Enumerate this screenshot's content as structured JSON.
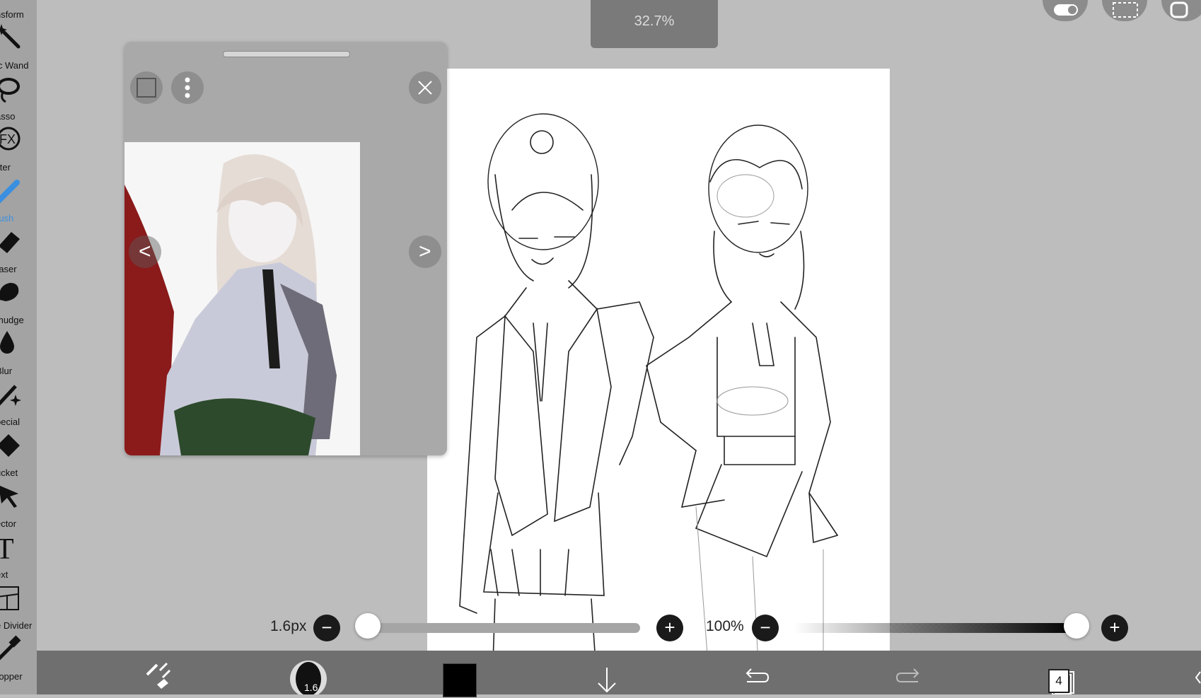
{
  "zoom_level": "32.7%",
  "toolbar": {
    "tools": [
      {
        "label": "nsform",
        "icon": "transform-icon"
      },
      {
        "label": "ic Wand",
        "icon": "magic-wand-icon"
      },
      {
        "label": "asso",
        "icon": "lasso-icon"
      },
      {
        "label": "ilter",
        "icon": "fx-filter-icon"
      },
      {
        "label": "rush",
        "icon": "brush-icon",
        "active": true
      },
      {
        "label": "raser",
        "icon": "eraser-icon"
      },
      {
        "label": "mudge",
        "icon": "smudge-icon"
      },
      {
        "label": "Blur",
        "icon": "blur-drop-icon"
      },
      {
        "label": "pecial",
        "icon": "special-pen-icon"
      },
      {
        "label": "ucket",
        "icon": "bucket-icon"
      },
      {
        "label": "ector",
        "icon": "selector-arrow-icon"
      },
      {
        "label": "ext",
        "icon": "text-t-icon"
      },
      {
        "label": "e Divider",
        "icon": "frame-divider-icon"
      },
      {
        "label": "ropper",
        "icon": "eyedropper-icon"
      }
    ],
    "fx_glyph": "FX",
    "text_glyph": "T"
  },
  "brush_size": {
    "label": "1.6px",
    "value_fraction": 0.04,
    "minus": "−",
    "plus": "+"
  },
  "opacity": {
    "label": "100%",
    "value_fraction": 1.0,
    "minus": "−",
    "plus": "+"
  },
  "bottom_bar": {
    "brush_thumb_label": "1.6",
    "layer_count": "4",
    "current_color": "#000000"
  },
  "reference_window": {
    "prev": "<",
    "next": ">"
  },
  "colors": {
    "accent": "#3b8fe0",
    "toolbar": "#a3a3a3",
    "bottom_bar": "#6f6f6f"
  }
}
